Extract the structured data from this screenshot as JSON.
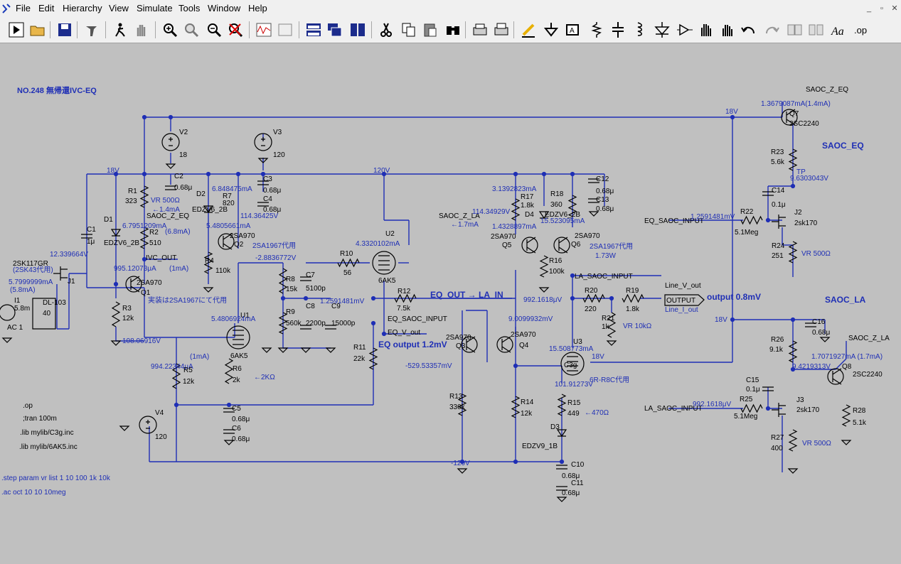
{
  "menu": [
    "File",
    "Edit",
    "Hierarchy",
    "View",
    "Simulate",
    "Tools",
    "Window",
    "Help"
  ],
  "window_buttons": [
    "_",
    "▫",
    "✕"
  ],
  "toolbar_icons": [
    "run-icon",
    "open-icon",
    "save-icon",
    "control-panel-icon",
    "run-stop-icon",
    "pan-icon",
    "zoom-in-icon",
    "zoom-area-icon",
    "zoom-out-icon",
    "zoom-cancel-icon",
    "waveform-icon",
    "autorange-icon",
    "tile-horizontal-icon",
    "cascade-icon",
    "tile-icon",
    "cut-icon",
    "copy-icon",
    "paste-icon",
    "find-icon",
    "print-setup-icon",
    "print-icon",
    "draw-wire-icon",
    "ground-icon",
    "label-net-icon",
    "resistor-icon",
    "capacitor-icon",
    "inductor-icon",
    "diode-icon",
    "component-icon",
    "move-icon",
    "drag-icon",
    "undo-icon",
    "redo-icon",
    "rotate-icon",
    "mirror-icon",
    "text-icon",
    "spice-directive-icon"
  ],
  "schematic": {
    "title": "NO.248 無帰還IVC-EQ",
    "labels": [
      {
        "t": "SAOC_Z_EQ",
        "c": "k"
      },
      {
        "t": "1.3679087mA(1.4mA)",
        "c": "b"
      },
      {
        "t": "Q7",
        "c": "k"
      },
      {
        "t": "2SC2240",
        "c": "k"
      },
      {
        "t": "18V",
        "c": "b"
      },
      {
        "t": "V2",
        "c": "k"
      },
      {
        "t": "18",
        "c": "k"
      },
      {
        "t": "V3",
        "c": "k"
      },
      {
        "t": "120",
        "c": "k"
      },
      {
        "t": "SAOC_EQ",
        "c": "b"
      },
      {
        "t": "R23",
        "c": "k"
      },
      {
        "t": "5.6k",
        "c": "k"
      },
      {
        "t": "TP",
        "c": "b"
      },
      {
        "t": "9.6303043V",
        "c": "b"
      },
      {
        "t": "18V",
        "c": "b"
      },
      {
        "t": "C2",
        "c": "k"
      },
      {
        "t": "0.68μ",
        "c": "k"
      },
      {
        "t": "120V",
        "c": "b"
      },
      {
        "t": "C12",
        "c": "k"
      },
      {
        "t": "0.68μ",
        "c": "k"
      },
      {
        "t": "C13",
        "c": "k"
      },
      {
        "t": "0.68μ",
        "c": "k"
      },
      {
        "t": "C3",
        "c": "k"
      },
      {
        "t": "0.68μ",
        "c": "k"
      },
      {
        "t": "C4",
        "c": "k"
      },
      {
        "t": "0.68μ",
        "c": "k"
      },
      {
        "t": "D2",
        "c": "k"
      },
      {
        "t": "EDZV6_2B",
        "c": "k"
      },
      {
        "t": "6.848475mA",
        "c": "b"
      },
      {
        "t": "R7",
        "c": "k"
      },
      {
        "t": "820",
        "c": "k"
      },
      {
        "t": "114.36425V",
        "c": "b"
      },
      {
        "t": "R1",
        "c": "k"
      },
      {
        "t": "323",
        "c": "k"
      },
      {
        "t": "VR 500Ω",
        "c": "b"
      },
      {
        "t": "←1.4mA",
        "c": "b"
      },
      {
        "t": "SAOC_Z_EQ",
        "c": "k"
      },
      {
        "t": "D1",
        "c": "k"
      },
      {
        "t": "6.7951209mA",
        "c": "b"
      },
      {
        "t": "R2",
        "c": "k"
      },
      {
        "t": "(6.8mA)",
        "c": "b"
      },
      {
        "t": "510",
        "c": "k"
      },
      {
        "t": "EDZV6_2B",
        "c": "k"
      },
      {
        "t": "C1",
        "c": "k"
      },
      {
        "t": "1μ",
        "c": "k"
      },
      {
        "t": "IVC_OUT",
        "c": "k"
      },
      {
        "t": "12.339664V",
        "c": "b"
      },
      {
        "t": "3.1392823mA",
        "c": "b"
      },
      {
        "t": "R17",
        "c": "k"
      },
      {
        "t": "1.8k",
        "c": "k"
      },
      {
        "t": "R18",
        "c": "k"
      },
      {
        "t": "360",
        "c": "k"
      },
      {
        "t": "SAOC_Z_LA",
        "c": "k"
      },
      {
        "t": "←1.7mA",
        "c": "b"
      },
      {
        "t": "114.34929V",
        "c": "b"
      },
      {
        "t": "D4",
        "c": "k"
      },
      {
        "t": "EDZV6_2B",
        "c": "k"
      },
      {
        "t": "1.4328897mA",
        "c": "b"
      },
      {
        "t": "15.523095mA",
        "c": "b"
      },
      {
        "t": "5.4805661mA",
        "c": "b"
      },
      {
        "t": "2SA970",
        "c": "k"
      },
      {
        "t": "Q2",
        "c": "k"
      },
      {
        "t": "2SA1967代用",
        "c": "b"
      },
      {
        "t": "U2",
        "c": "k"
      },
      {
        "t": "4.3320102mA",
        "c": "b"
      },
      {
        "t": "2SA970",
        "c": "k"
      },
      {
        "t": "Q5",
        "c": "k"
      },
      {
        "t": "2SA970",
        "c": "k"
      },
      {
        "t": "Q6",
        "c": "k"
      },
      {
        "t": "2SA1967代用",
        "c": "b"
      },
      {
        "t": "1.73W",
        "c": "b"
      },
      {
        "t": "R4",
        "c": "k"
      },
      {
        "t": "110k",
        "c": "k"
      },
      {
        "t": "-2.8836772V",
        "c": "b"
      },
      {
        "t": "R10",
        "c": "k"
      },
      {
        "t": "56",
        "c": "k"
      },
      {
        "t": "6AK5",
        "c": "k"
      },
      {
        "t": "R16",
        "c": "k"
      },
      {
        "t": "100k",
        "c": "k"
      },
      {
        "t": "LA_SAOC_INPUT",
        "c": "k"
      },
      {
        "t": "2SK117GR",
        "c": "k"
      },
      {
        "t": "(2SK43代用)",
        "c": "b"
      },
      {
        "t": "J1",
        "c": "k"
      },
      {
        "t": "5.7999999mA",
        "c": "b"
      },
      {
        "t": "(5.8mA)",
        "c": "b"
      },
      {
        "t": "995.12073μA",
        "c": "b"
      },
      {
        "t": "(1mA)",
        "c": "b"
      },
      {
        "t": "2SA970",
        "c": "k"
      },
      {
        "t": "Q1",
        "c": "k"
      },
      {
        "t": "実装は2SA1967にて代用",
        "c": "b"
      },
      {
        "t": "R8",
        "c": "k"
      },
      {
        "t": "15k",
        "c": "k"
      },
      {
        "t": "C7",
        "c": "k"
      },
      {
        "t": "5100p",
        "c": "k"
      },
      {
        "t": "R12",
        "c": "k"
      },
      {
        "t": "7.5k",
        "c": "k"
      },
      {
        "t": "EQ_OUT → LA_IN",
        "c": "b"
      },
      {
        "t": "9.0099932mV",
        "c": "b"
      },
      {
        "t": "R20",
        "c": "k"
      },
      {
        "t": "220",
        "c": "k"
      },
      {
        "t": "R19",
        "c": "k"
      },
      {
        "t": "1.8k",
        "c": "k"
      },
      {
        "t": "Line_V_out",
        "c": "k"
      },
      {
        "t": "I1",
        "c": "k"
      },
      {
        "t": "5.8m",
        "c": "k"
      },
      {
        "t": "AC 1",
        "c": "k"
      },
      {
        "t": "DL-103",
        "c": "k"
      },
      {
        "t": "40",
        "c": "k"
      },
      {
        "t": "R3",
        "c": "k"
      },
      {
        "t": "12k",
        "c": "k"
      },
      {
        "t": "R9",
        "c": "k"
      },
      {
        "t": "560k",
        "c": "k"
      },
      {
        "t": "C8",
        "c": "k"
      },
      {
        "t": "2200p",
        "c": "k"
      },
      {
        "t": "C9",
        "c": "k"
      },
      {
        "t": "15000p",
        "c": "k"
      },
      {
        "t": "1.2591481mV",
        "c": "b"
      },
      {
        "t": "992.1618μV",
        "c": "b"
      },
      {
        "t": "OUTPUT",
        "c": "k"
      },
      {
        "t": "output 0.8mV",
        "c": "b"
      },
      {
        "t": "Line_I_out",
        "c": "b"
      },
      {
        "t": "U1",
        "c": "k"
      },
      {
        "t": "5.4806924mA",
        "c": "b"
      },
      {
        "t": "EQ_SAOC_INPUT",
        "c": "k"
      },
      {
        "t": "R21",
        "c": "k"
      },
      {
        "t": "1k",
        "c": "k"
      },
      {
        "t": "VR 10kΩ",
        "c": "b"
      },
      {
        "t": "EQ_V_out",
        "c": "k"
      },
      {
        "t": "2SA970",
        "c": "k"
      },
      {
        "t": "Q3",
        "c": "k"
      },
      {
        "t": "2SA970",
        "c": "k"
      },
      {
        "t": "Q4",
        "c": "k"
      },
      {
        "t": "108.06916V",
        "c": "b"
      },
      {
        "t": "(1mA)",
        "c": "b"
      },
      {
        "t": "6AK5",
        "c": "k"
      },
      {
        "t": "R11",
        "c": "k"
      },
      {
        "t": "22k",
        "c": "k"
      },
      {
        "t": "EQ output 1.2mV",
        "c": "b"
      },
      {
        "t": "U3",
        "c": "k"
      },
      {
        "t": "15.508773mA",
        "c": "b"
      },
      {
        "t": "18V",
        "c": "b"
      },
      {
        "t": "994.22344μA",
        "c": "b"
      },
      {
        "t": "R5",
        "c": "k"
      },
      {
        "t": "12k",
        "c": "k"
      },
      {
        "t": "R6",
        "c": "k"
      },
      {
        "t": "2k",
        "c": "k"
      },
      {
        "t": "←2KΩ",
        "c": "b"
      },
      {
        "t": "-529.53357mV",
        "c": "b"
      },
      {
        "t": "C3g",
        "c": "k"
      },
      {
        "t": "6R-R8C代用",
        "c": "b"
      },
      {
        "t": "R13",
        "c": "k"
      },
      {
        "t": "330k",
        "c": "k"
      },
      {
        "t": "R14",
        "c": "k"
      },
      {
        "t": "12k",
        "c": "k"
      },
      {
        "t": "101.91273V",
        "c": "b"
      },
      {
        "t": "R15",
        "c": "k"
      },
      {
        "t": "449",
        "c": "k"
      },
      {
        "t": "←470Ω",
        "c": "b"
      },
      {
        "t": ".op",
        "c": "k"
      },
      {
        "t": ";tran 100m",
        "c": "k"
      },
      {
        "t": ".lib mylib/C3g.inc",
        "c": "k"
      },
      {
        "t": ".lib mylib/6AK5.inc",
        "c": "k"
      },
      {
        "t": "C5",
        "c": "k"
      },
      {
        "t": "0.68μ",
        "c": "k"
      },
      {
        "t": "C6",
        "c": "k"
      },
      {
        "t": "0.68μ",
        "c": "k"
      },
      {
        "t": "V4",
        "c": "k"
      },
      {
        "t": "120",
        "c": "k"
      },
      {
        "t": "D3",
        "c": "k"
      },
      {
        "t": "EDZV9_1B",
        "c": "k"
      },
      {
        "t": "-120V",
        "c": "b"
      },
      {
        "t": "C10",
        "c": "k"
      },
      {
        "t": "0.68μ",
        "c": "k"
      },
      {
        "t": "C11",
        "c": "k"
      },
      {
        "t": "0.68μ",
        "c": "k"
      },
      {
        "t": ".step param vr list 1 10 100 1k 10k",
        "c": "b"
      },
      {
        "t": ".ac oct 10 10 10meg",
        "c": "b"
      },
      {
        "t": "EQ_SAOC_INPUT",
        "c": "k"
      },
      {
        "t": "1.2591481mV",
        "c": "b"
      },
      {
        "t": "R22",
        "c": "k"
      },
      {
        "t": "5.1Meg",
        "c": "k"
      },
      {
        "t": "C14",
        "c": "k"
      },
      {
        "t": "0.1μ",
        "c": "k"
      },
      {
        "t": "J2",
        "c": "k"
      },
      {
        "t": "2sk170",
        "c": "k"
      },
      {
        "t": "R24",
        "c": "k"
      },
      {
        "t": "251",
        "c": "k"
      },
      {
        "t": "VR 500Ω",
        "c": "b"
      },
      {
        "t": "SAOC_LA",
        "c": "b"
      },
      {
        "t": "18V",
        "c": "b"
      },
      {
        "t": "C16",
        "c": "k"
      },
      {
        "t": "0.68μ",
        "c": "k"
      },
      {
        "t": "R26",
        "c": "k"
      },
      {
        "t": "9.1k",
        "c": "k"
      },
      {
        "t": "SAOC_Z_LA",
        "c": "k"
      },
      {
        "t": "1.7071927mA (1.7mA)",
        "c": "b"
      },
      {
        "t": "9.4219313V",
        "c": "b"
      },
      {
        "t": "Q8",
        "c": "k"
      },
      {
        "t": "2SC2240",
        "c": "k"
      },
      {
        "t": "C15",
        "c": "k"
      },
      {
        "t": "0.1μ",
        "c": "k"
      },
      {
        "t": "LA_SAOC_INPUT",
        "c": "k"
      },
      {
        "t": "992.1618μV",
        "c": "b"
      },
      {
        "t": "R25",
        "c": "k"
      },
      {
        "t": "5.1Meg",
        "c": "k"
      },
      {
        "t": "J3",
        "c": "k"
      },
      {
        "t": "2sk170",
        "c": "k"
      },
      {
        "t": "R28",
        "c": "k"
      },
      {
        "t": "5.1k",
        "c": "k"
      },
      {
        "t": "R27",
        "c": "k"
      },
      {
        "t": "400",
        "c": "k"
      },
      {
        "t": "VR 500Ω",
        "c": "b"
      }
    ]
  }
}
